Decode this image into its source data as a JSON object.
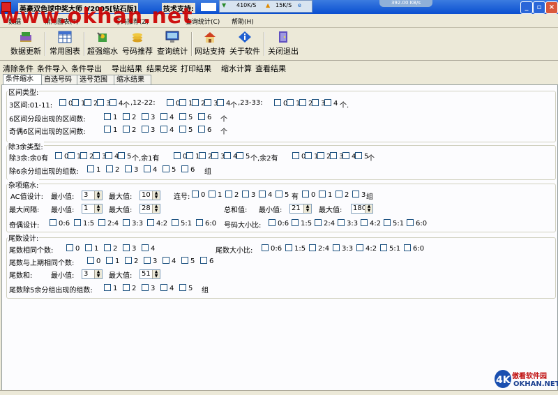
{
  "window": {
    "title": "英豪双色球中奖大师    V2005[钻石版]",
    "tech_label": "技术支持:",
    "watermark": "www.okhan.net",
    "net_down": "410K/S",
    "net_up": "15K/S",
    "net_total": "392.00 KB/s",
    "buttons": {
      "minimize": "_",
      "restore": "▫",
      "close": "×"
    }
  },
  "menu": [
    "数据",
    "常用图表(T)",
    "号码推荐(Z)",
    "查询统计(C)",
    "帮助(H)"
  ],
  "toolbar": [
    {
      "label": "数据更新",
      "icon": "books-icon"
    },
    {
      "label": "常用图表",
      "icon": "grid-icon"
    },
    {
      "label": "超强缩水",
      "icon": "tools-icon"
    },
    {
      "label": "号码推荐",
      "icon": "coins-icon"
    },
    {
      "label": "查询统计",
      "icon": "monitor-icon"
    },
    {
      "label": "网站支持",
      "icon": "house-icon"
    },
    {
      "label": "关于软件",
      "icon": "info-icon"
    },
    {
      "label": "关闭退出",
      "icon": "door-icon"
    }
  ],
  "commands": [
    "清除条件",
    "条件导入",
    "条件导出",
    "导出结果",
    "结果兑奖",
    "打印结果",
    "缩水计算",
    "查看结果"
  ],
  "tabs": [
    "条件缩水",
    "自选号码",
    "选号范围",
    "缩水结果"
  ],
  "zone": {
    "title": "区间类型:",
    "r1_label": "3区间:01-11:",
    "opts04": [
      "0",
      "1",
      "2",
      "3",
      "4"
    ],
    "unit": "个",
    "r1_mid": ",12-22:",
    "r1_mid2": ",23-33:",
    "r1_end": "个.",
    "r2_label": "6区间分段出现的区间数:",
    "opts16": [
      "1",
      "2",
      "3",
      "4",
      "5",
      "6"
    ],
    "r3_label": "奇偶6区间出现的区间数:"
  },
  "mod3": {
    "title": "除3余类型:",
    "r1_label": "除3余:余0有",
    "opts05": [
      "0",
      "1",
      "2",
      "3",
      "4",
      "5"
    ],
    "unit": "个",
    "r1_mid": "个,余1有",
    "r1_mid2": "个,余2有",
    "r2_label": "除6余分组出现的组数:",
    "opts16": [
      "1",
      "2",
      "3",
      "4",
      "5",
      "6"
    ],
    "r2_end": "组"
  },
  "misc": {
    "title": "杂项缩水:",
    "ac_label": "AC值设计:",
    "min_label": "最小值:",
    "max_label": "最大值:",
    "ac_min": "3",
    "ac_max": "10",
    "consec_label": "连号:",
    "consec_opts": [
      "0",
      "1",
      "2",
      "3",
      "4",
      "5"
    ],
    "has_label": "有",
    "has_opts": [
      "0",
      "1",
      "2",
      "3"
    ],
    "group_label": "组",
    "gap_label": "最大间隔:",
    "gap_min": "1",
    "gap_max": "28",
    "sum_label": "总和值:",
    "sum_min": "21",
    "sum_max": "180",
    "odd_label": "奇偶设计:",
    "ratio_opts": [
      "0:6",
      "1:5",
      "2:4",
      "3:3",
      "4:2",
      "5:1",
      "6:0"
    ],
    "size_label": "号码大小比:"
  },
  "tail": {
    "title": "尾数设计:",
    "same_label": "尾数相同个数:",
    "opts04": [
      "0",
      "1",
      "2",
      "3",
      "4"
    ],
    "size_label": "尾数大小比:",
    "ratio_opts": [
      "0:6",
      "1:5",
      "2:4",
      "3:3",
      "4:2",
      "5:1",
      "6:0"
    ],
    "prev_label": "尾数与上期相同个数:",
    "opts06": [
      "0",
      "1",
      "2",
      "3",
      "4",
      "5",
      "6"
    ],
    "sum_label": "尾数和:",
    "min_label": "最小值:",
    "max_label": "最大值:",
    "sum_min": "3",
    "sum_max": "51",
    "mod5_label": "尾数除5余分组出现的组数:",
    "opts15": [
      "1",
      "2",
      "3",
      "4",
      "5"
    ],
    "group_label": "组"
  },
  "logo": {
    "brand": "傲看软件园",
    "url": "OKHAN.NET",
    "mark": "4K"
  },
  "colors": {
    "titlebar": "#0a4fd0",
    "watermark": "#cc0000",
    "panel_bg": "#fcfcfe",
    "face": "#ece9d8"
  }
}
